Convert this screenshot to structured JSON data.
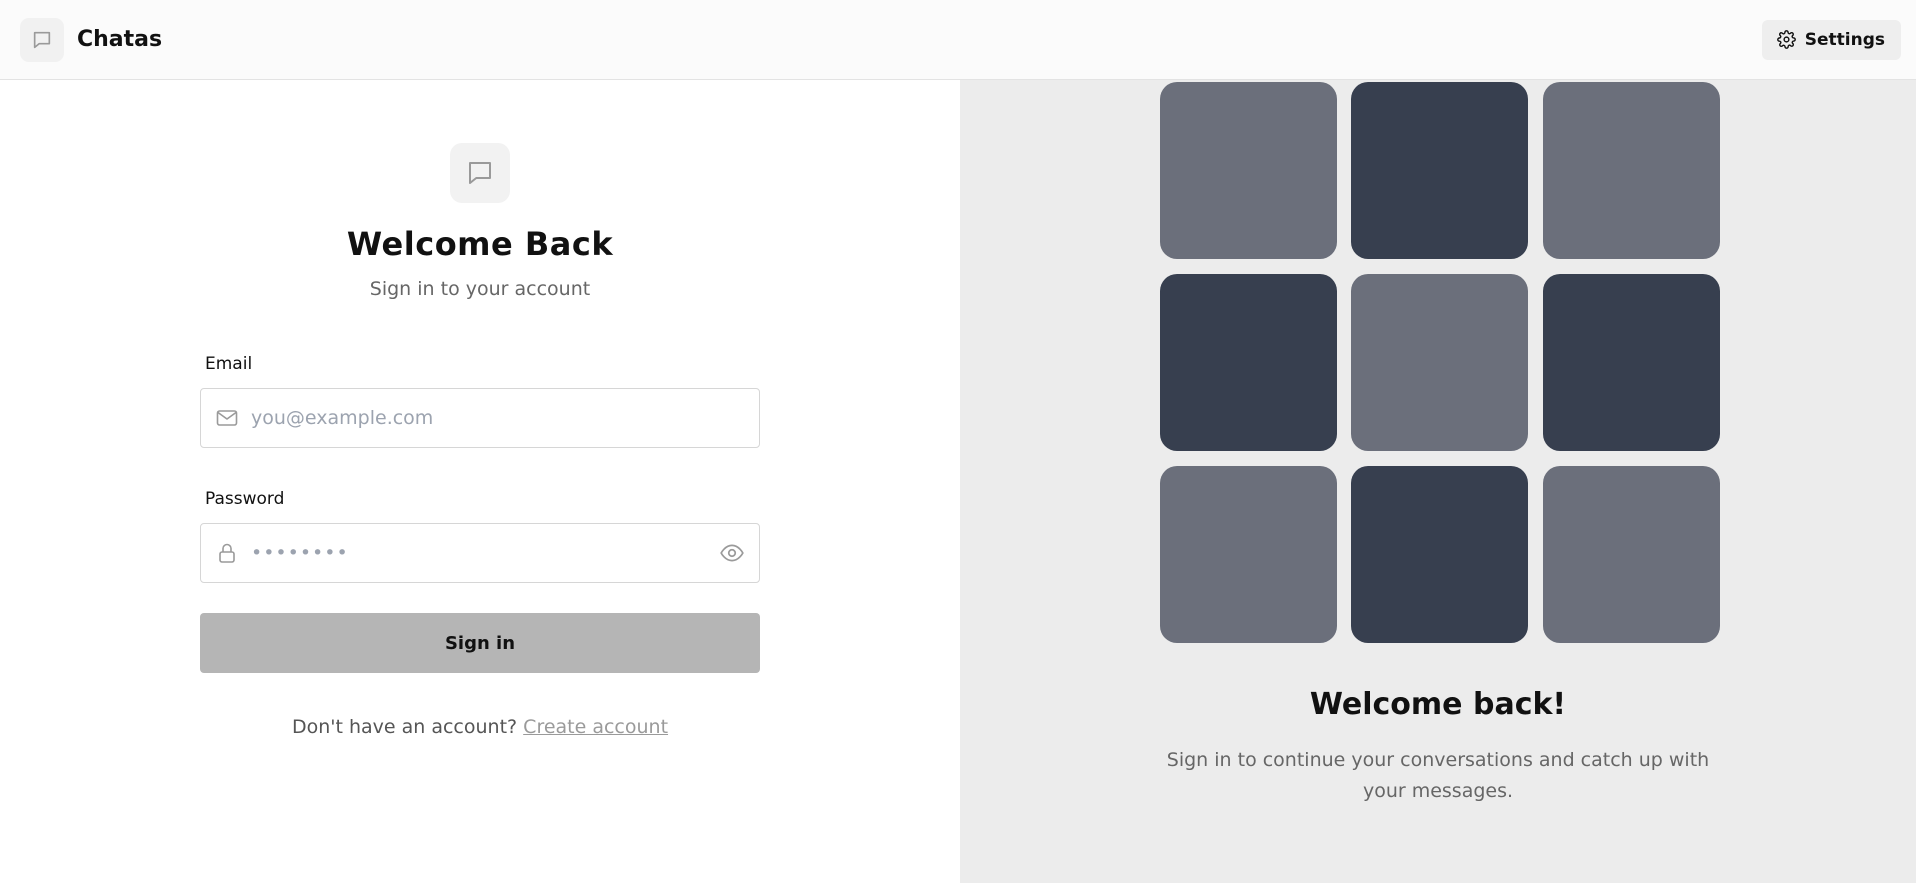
{
  "header": {
    "brand_icon": "chat-bubble-icon",
    "brand_name": "Chatas",
    "settings_label": "Settings",
    "settings_icon": "gear-icon"
  },
  "login": {
    "logo_icon": "chat-bubble-icon",
    "title": "Welcome Back",
    "subtitle": "Sign in to your account",
    "email": {
      "label": "Email",
      "icon": "mail-icon",
      "placeholder": "you@example.com",
      "value": ""
    },
    "password": {
      "label": "Password",
      "icon": "lock-icon",
      "masked_value": "••••••••",
      "toggle_icon": "eye-icon"
    },
    "submit_label": "Sign in",
    "signup_prompt": "Don't have an account?",
    "signup_link": "Create account"
  },
  "promo": {
    "tiles": [
      "light",
      "dark",
      "light",
      "dark",
      "light",
      "dark",
      "light",
      "dark",
      "light"
    ],
    "title": "Welcome back!",
    "text": "Sign in to continue your conversations and catch up with your messages."
  },
  "colors": {
    "tile_light": "#6b6f7b",
    "tile_dark": "#373f4f",
    "button_bg": "#b5b5b5",
    "panel_bg": "#ececec"
  }
}
